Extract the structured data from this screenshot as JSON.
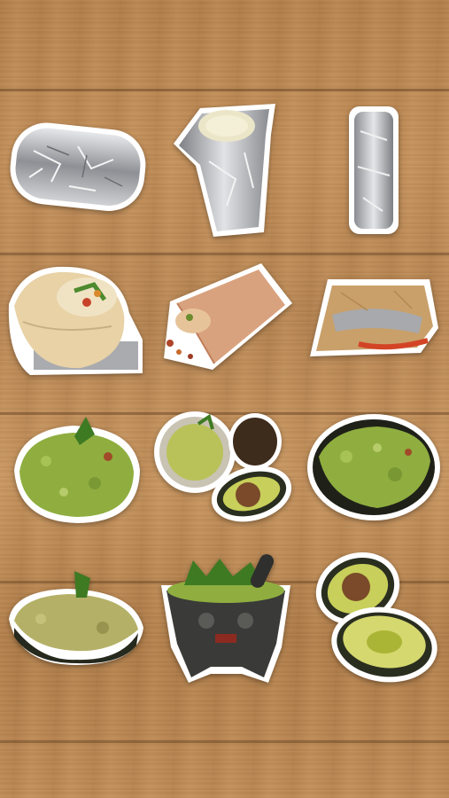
{
  "screen": {
    "background": "wood-planks",
    "stickers": [
      {
        "name": "foil-wrapped-burrito-horizontal"
      },
      {
        "name": "foil-wrapped-burrito-open-top"
      },
      {
        "name": "foil-wrapped-burrito-vertical"
      },
      {
        "name": "tortilla-burrito-bitten"
      },
      {
        "name": "flour-burrito-spilling"
      },
      {
        "name": "burrito-in-paper-wrap"
      },
      {
        "name": "guacamole-mound-cilantro"
      },
      {
        "name": "guacamole-bowl-with-avocados"
      },
      {
        "name": "guacamole-dark-bowl"
      },
      {
        "name": "guacamole-avocado-shell"
      },
      {
        "name": "molcajete-guacamole"
      },
      {
        "name": "halved-avocados"
      }
    ]
  },
  "colors": {
    "foil": "#b9babd",
    "tortilla": "#e8d2a6",
    "guacamole": "#8fae3f",
    "avocado_skin": "#2a2e1f",
    "avocado_flesh": "#c8cf5a",
    "avocado_pit": "#7a4a2a"
  }
}
